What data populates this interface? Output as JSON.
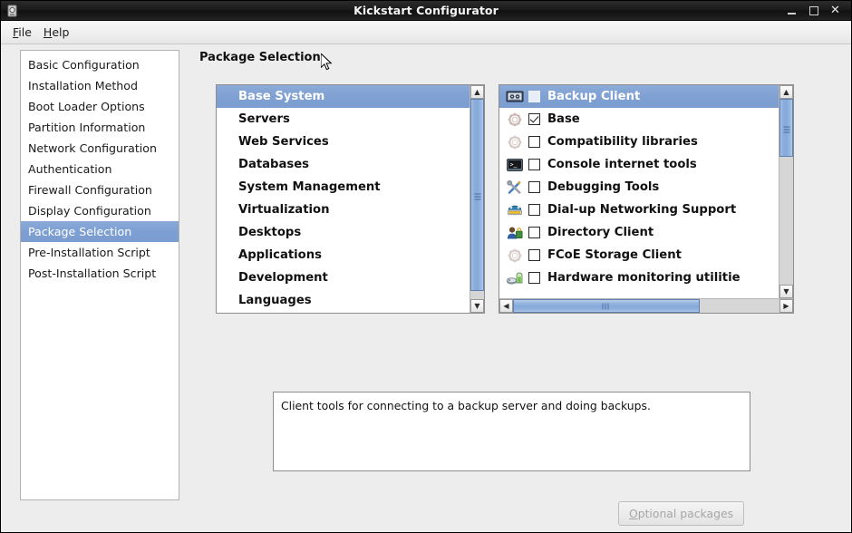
{
  "window": {
    "title": "Kickstart Configurator",
    "app_icon": "app-icon",
    "buttons": {
      "minimize": "minimize",
      "maximize": "maximize",
      "close": "close"
    }
  },
  "menubar": {
    "items": [
      {
        "label": "File",
        "mnemonic": "F",
        "rest": "ile"
      },
      {
        "label": "Help",
        "mnemonic": "H",
        "rest": "elp"
      }
    ]
  },
  "sidebar": {
    "items": [
      {
        "label": "Basic Configuration",
        "selected": false
      },
      {
        "label": "Installation Method",
        "selected": false
      },
      {
        "label": "Boot Loader Options",
        "selected": false
      },
      {
        "label": "Partition Information",
        "selected": false
      },
      {
        "label": "Network Configuration",
        "selected": false
      },
      {
        "label": "Authentication",
        "selected": false
      },
      {
        "label": "Firewall Configuration",
        "selected": false
      },
      {
        "label": "Display Configuration",
        "selected": false
      },
      {
        "label": "Package Selection",
        "selected": true
      },
      {
        "label": "Pre-Installation Script",
        "selected": false
      },
      {
        "label": "Post-Installation Script",
        "selected": false
      }
    ]
  },
  "main": {
    "page_title": "Package Selection",
    "group_list": {
      "items": [
        {
          "label": "Base System",
          "selected": true
        },
        {
          "label": "Servers",
          "selected": false
        },
        {
          "label": "Web Services",
          "selected": false
        },
        {
          "label": "Databases",
          "selected": false
        },
        {
          "label": "System Management",
          "selected": false
        },
        {
          "label": "Virtualization",
          "selected": false
        },
        {
          "label": "Desktops",
          "selected": false
        },
        {
          "label": "Applications",
          "selected": false
        },
        {
          "label": "Development",
          "selected": false
        },
        {
          "label": "Languages",
          "selected": false
        }
      ],
      "scrollbar": {
        "thumb_top_pct": 0,
        "thumb_height_pct": 96
      }
    },
    "package_list": {
      "items": [
        {
          "label": "Backup Client",
          "icon": "tape-drive-icon",
          "checked": false,
          "selected": true
        },
        {
          "label": "Base",
          "icon": "gear-icon",
          "checked": true,
          "selected": false
        },
        {
          "label": "Compatibility libraries",
          "icon": "gear-icon",
          "checked": false,
          "selected": false
        },
        {
          "label": "Console internet tools",
          "icon": "terminal-icon",
          "checked": false,
          "selected": false
        },
        {
          "label": "Debugging Tools",
          "icon": "tools-icon",
          "checked": false,
          "selected": false
        },
        {
          "label": "Dial-up Networking Support",
          "icon": "telephone-icon",
          "checked": false,
          "selected": false
        },
        {
          "label": "Directory Client",
          "icon": "user-icon",
          "checked": false,
          "selected": false
        },
        {
          "label": "FCoE Storage Client",
          "icon": "gear-icon",
          "checked": false,
          "selected": false
        },
        {
          "label": "Hardware monitoring utilitie",
          "icon": "hardware-monitor-icon",
          "checked": false,
          "selected": false
        }
      ],
      "vscrollbar": {
        "thumb_top_pct": 0,
        "thumb_height_pct": 31
      },
      "hscrollbar": {
        "thumb_left_pct": 0,
        "thumb_width_pct": 70
      }
    },
    "description": "Client tools for connecting to a backup server and doing backups.",
    "optional_button": {
      "label": "Optional packages",
      "mnemonic": "O",
      "rest": "ptional packages",
      "disabled": true
    }
  },
  "colors": {
    "selection_blue": "#7f9fd2",
    "titlebar_dark": "#1a1a1a",
    "window_bg": "#ededed",
    "list_bg": "#ffffff",
    "scrollbar_thumb": "#85a8d9"
  }
}
